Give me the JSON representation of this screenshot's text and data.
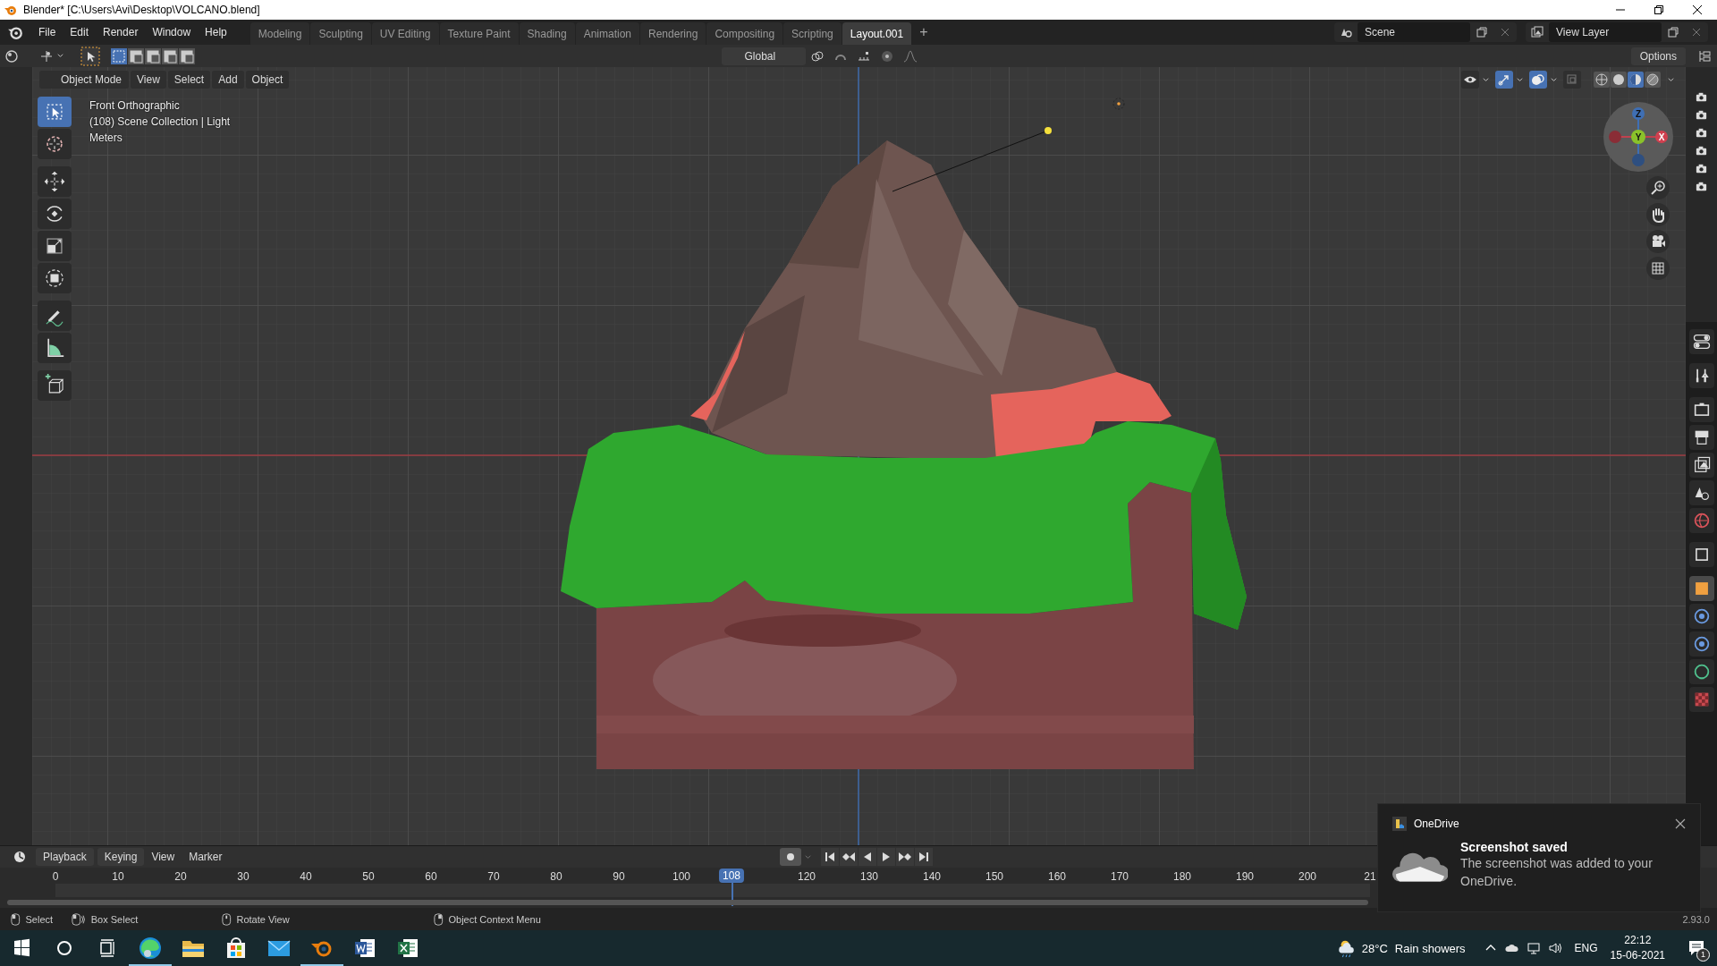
{
  "window": {
    "title": "Blender* [C:\\Users\\Avi\\Desktop\\VOLCANO.blend]"
  },
  "menu": [
    "File",
    "Edit",
    "Render",
    "Window",
    "Help"
  ],
  "workspaces": [
    {
      "label": "Modeling",
      "selected": false
    },
    {
      "label": "Sculpting",
      "selected": false
    },
    {
      "label": "UV Editing",
      "selected": false
    },
    {
      "label": "Texture Paint",
      "selected": false
    },
    {
      "label": "Shading",
      "selected": false
    },
    {
      "label": "Animation",
      "selected": false
    },
    {
      "label": "Rendering",
      "selected": false
    },
    {
      "label": "Compositing",
      "selected": false
    },
    {
      "label": "Scripting",
      "selected": false
    },
    {
      "label": "Layout.001",
      "selected": true
    }
  ],
  "new_workspace": "+",
  "scene": "Scene",
  "view_layer": "View Layer",
  "tool_header": {
    "select_modes": [
      {
        "selected": true
      },
      {
        "selected": false
      },
      {
        "selected": false
      },
      {
        "selected": false
      },
      {
        "selected": false
      }
    ],
    "orientation": "Global",
    "options": "Options"
  },
  "viewport": {
    "mode": "Object Mode",
    "menus": [
      "View",
      "Select",
      "Add",
      "Object"
    ],
    "info": [
      "Front Orthographic",
      "(108) Scene Collection | Light",
      "Meters"
    ],
    "tools": [
      {
        "kind": "select",
        "selected": true
      },
      {
        "kind": "cursor",
        "selected": false
      },
      {
        "kind": "move",
        "selected": false
      },
      {
        "kind": "rotate",
        "selected": false
      },
      {
        "kind": "scale",
        "selected": false
      },
      {
        "kind": "transform",
        "selected": false
      },
      {
        "kind": "annotate",
        "selected": false
      },
      {
        "kind": "measure",
        "selected": false
      },
      {
        "kind": "add_cube",
        "selected": false
      }
    ],
    "toggles": [
      {
        "kind": "visibility",
        "on": false
      },
      {
        "kind": "gizmos",
        "on": true
      },
      {
        "kind": "overlays",
        "on": true
      },
      {
        "kind": "xray",
        "on": false
      }
    ],
    "shading": [
      {
        "kind": "wireframe",
        "selected": false
      },
      {
        "kind": "solid",
        "selected": false
      },
      {
        "kind": "material",
        "selected": true
      },
      {
        "kind": "rendered",
        "selected": false
      }
    ],
    "gizmo": {
      "z": "Z",
      "y": "Y",
      "x": "X"
    }
  },
  "properties_tabs": [
    {
      "kind": "tool",
      "selected": false
    },
    {
      "kind": "render",
      "selected": false
    },
    {
      "kind": "output",
      "selected": false
    },
    {
      "kind": "view_layer",
      "selected": false
    },
    {
      "kind": "scene",
      "selected": false
    },
    {
      "kind": "world",
      "selected": false
    },
    {
      "kind": "collection",
      "selected": false
    },
    {
      "kind": "object",
      "selected": true
    },
    {
      "kind": "physics",
      "selected": false
    },
    {
      "kind": "constraints",
      "selected": false
    },
    {
      "kind": "light",
      "selected": false
    },
    {
      "kind": "texture",
      "selected": false
    }
  ],
  "timeline": {
    "menus": [
      "Playback",
      "Keying",
      "View",
      "Marker"
    ],
    "ticks": [
      "0",
      "10",
      "20",
      "30",
      "40",
      "50",
      "60",
      "70",
      "80",
      "90",
      "100",
      "120",
      "130",
      "140",
      "150",
      "160",
      "170",
      "180",
      "190",
      "200",
      "21"
    ],
    "current_frame": "108"
  },
  "status_bar": {
    "hints": [
      {
        "kind": "left_click",
        "label": "Select"
      },
      {
        "kind": "drag",
        "label": "Box Select"
      },
      {
        "kind": "middle_click",
        "label": "Rotate View"
      },
      {
        "kind": "right_click",
        "label": "Object Context Menu"
      }
    ],
    "version": "2.93.0"
  },
  "notification": {
    "app": "OneDrive",
    "title": "Screenshot saved",
    "body": "The screenshot was added to your OneDrive."
  },
  "taskbar": {
    "apps": [
      {
        "kind": "edge",
        "running": true
      },
      {
        "kind": "explorer",
        "running": false
      },
      {
        "kind": "store",
        "running": false
      },
      {
        "kind": "mail",
        "running": false
      },
      {
        "kind": "blender",
        "running": true
      },
      {
        "kind": "word",
        "running": false
      },
      {
        "kind": "excel",
        "running": false
      }
    ],
    "temperature": "28°C",
    "weather": "Rain showers",
    "language": "ENG",
    "time": "22:12",
    "date": "15-06-2021",
    "notifications": "1"
  }
}
